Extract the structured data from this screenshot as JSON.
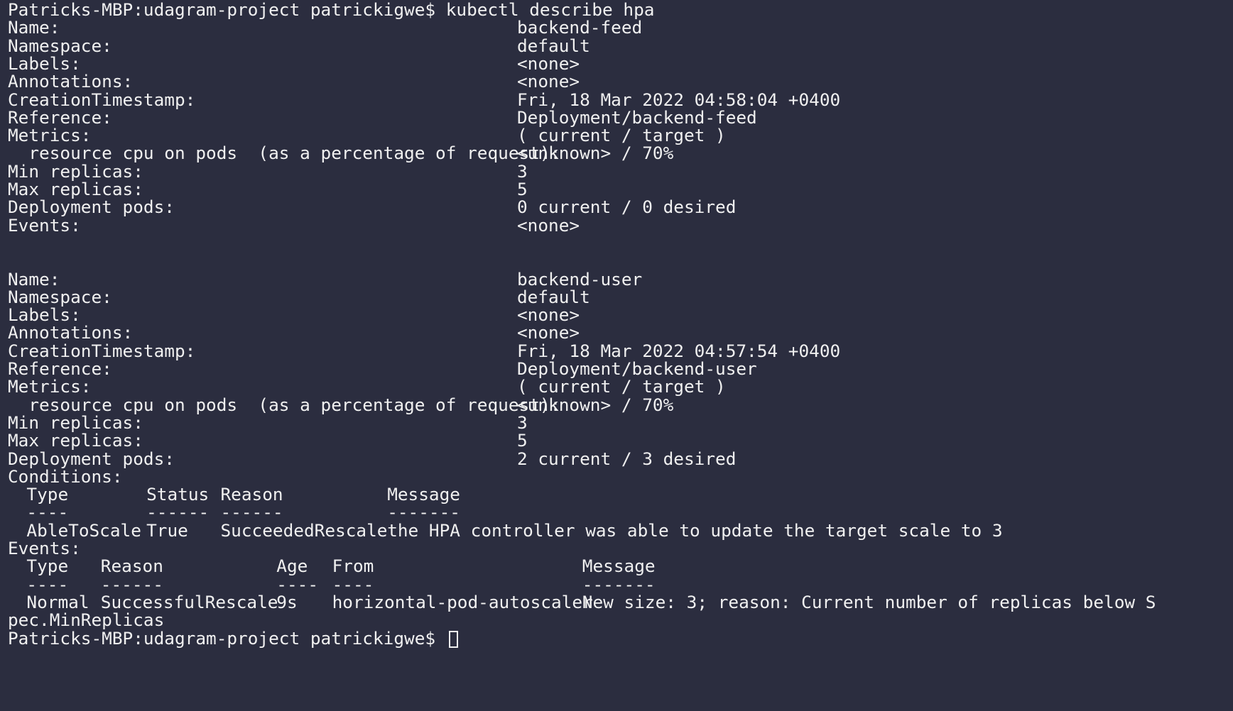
{
  "prompt": "Patricks-MBP:udagram-project patrickigwe$ ",
  "command": "kubectl describe hpa",
  "hpa_1": {
    "name": {
      "label": "Name:",
      "value": "backend-feed"
    },
    "namespace": {
      "label": "Namespace:",
      "value": "default"
    },
    "labels": {
      "label": "Labels:",
      "value": "<none>"
    },
    "annotations": {
      "label": "Annotations:",
      "value": "<none>"
    },
    "creation": {
      "label": "CreationTimestamp:",
      "value": "Fri, 18 Mar 2022 04:58:04 +0400"
    },
    "reference": {
      "label": "Reference:",
      "value": "Deployment/backend-feed"
    },
    "metrics": {
      "label": "Metrics:",
      "value": "( current / target )"
    },
    "metric_cpu": {
      "label": "  resource cpu on pods  (as a percentage of request):",
      "value": "<unknown> / 70%"
    },
    "min_replicas": {
      "label": "Min replicas:",
      "value": "3"
    },
    "max_replicas": {
      "label": "Max replicas:",
      "value": "5"
    },
    "deployment_pods": {
      "label": "Deployment pods:",
      "value": "0 current / 0 desired"
    },
    "events": {
      "label": "Events:",
      "value": "<none>"
    }
  },
  "hpa_2": {
    "name": {
      "label": "Name:",
      "value": "backend-user"
    },
    "namespace": {
      "label": "Namespace:",
      "value": "default"
    },
    "labels": {
      "label": "Labels:",
      "value": "<none>"
    },
    "annotations": {
      "label": "Annotations:",
      "value": "<none>"
    },
    "creation": {
      "label": "CreationTimestamp:",
      "value": "Fri, 18 Mar 2022 04:57:54 +0400"
    },
    "reference": {
      "label": "Reference:",
      "value": "Deployment/backend-user"
    },
    "metrics": {
      "label": "Metrics:",
      "value": "( current / target )"
    },
    "metric_cpu": {
      "label": "  resource cpu on pods  (as a percentage of request):",
      "value": "<unknown> / 70%"
    },
    "min_replicas": {
      "label": "Min replicas:",
      "value": "3"
    },
    "max_replicas": {
      "label": "Max replicas:",
      "value": "5"
    },
    "deployment_pods": {
      "label": "Deployment pods:",
      "value": "2 current / 3 desired"
    },
    "conditions_label": "Conditions:",
    "conditions": {
      "headers": [
        "Type",
        "Status",
        "Reason",
        "Message"
      ],
      "separators": [
        "----",
        "------",
        "------",
        "-------"
      ],
      "rows": [
        [
          "AbleToScale",
          "True",
          "SucceededRescale",
          "the HPA controller was able to update the target scale to 3"
        ]
      ]
    },
    "events_label": "Events:",
    "events": {
      "headers": [
        "Type",
        "Reason",
        "Age",
        "From",
        "Message"
      ],
      "separators": [
        "----",
        "------",
        "----",
        "----",
        "-------"
      ],
      "rows": [
        [
          "Normal",
          "SuccessfulRescale",
          "9s",
          "horizontal-pod-autoscaler",
          "New size: 3; reason: Current number of replicas below S"
        ]
      ],
      "wrap": "pec.MinReplicas"
    }
  }
}
